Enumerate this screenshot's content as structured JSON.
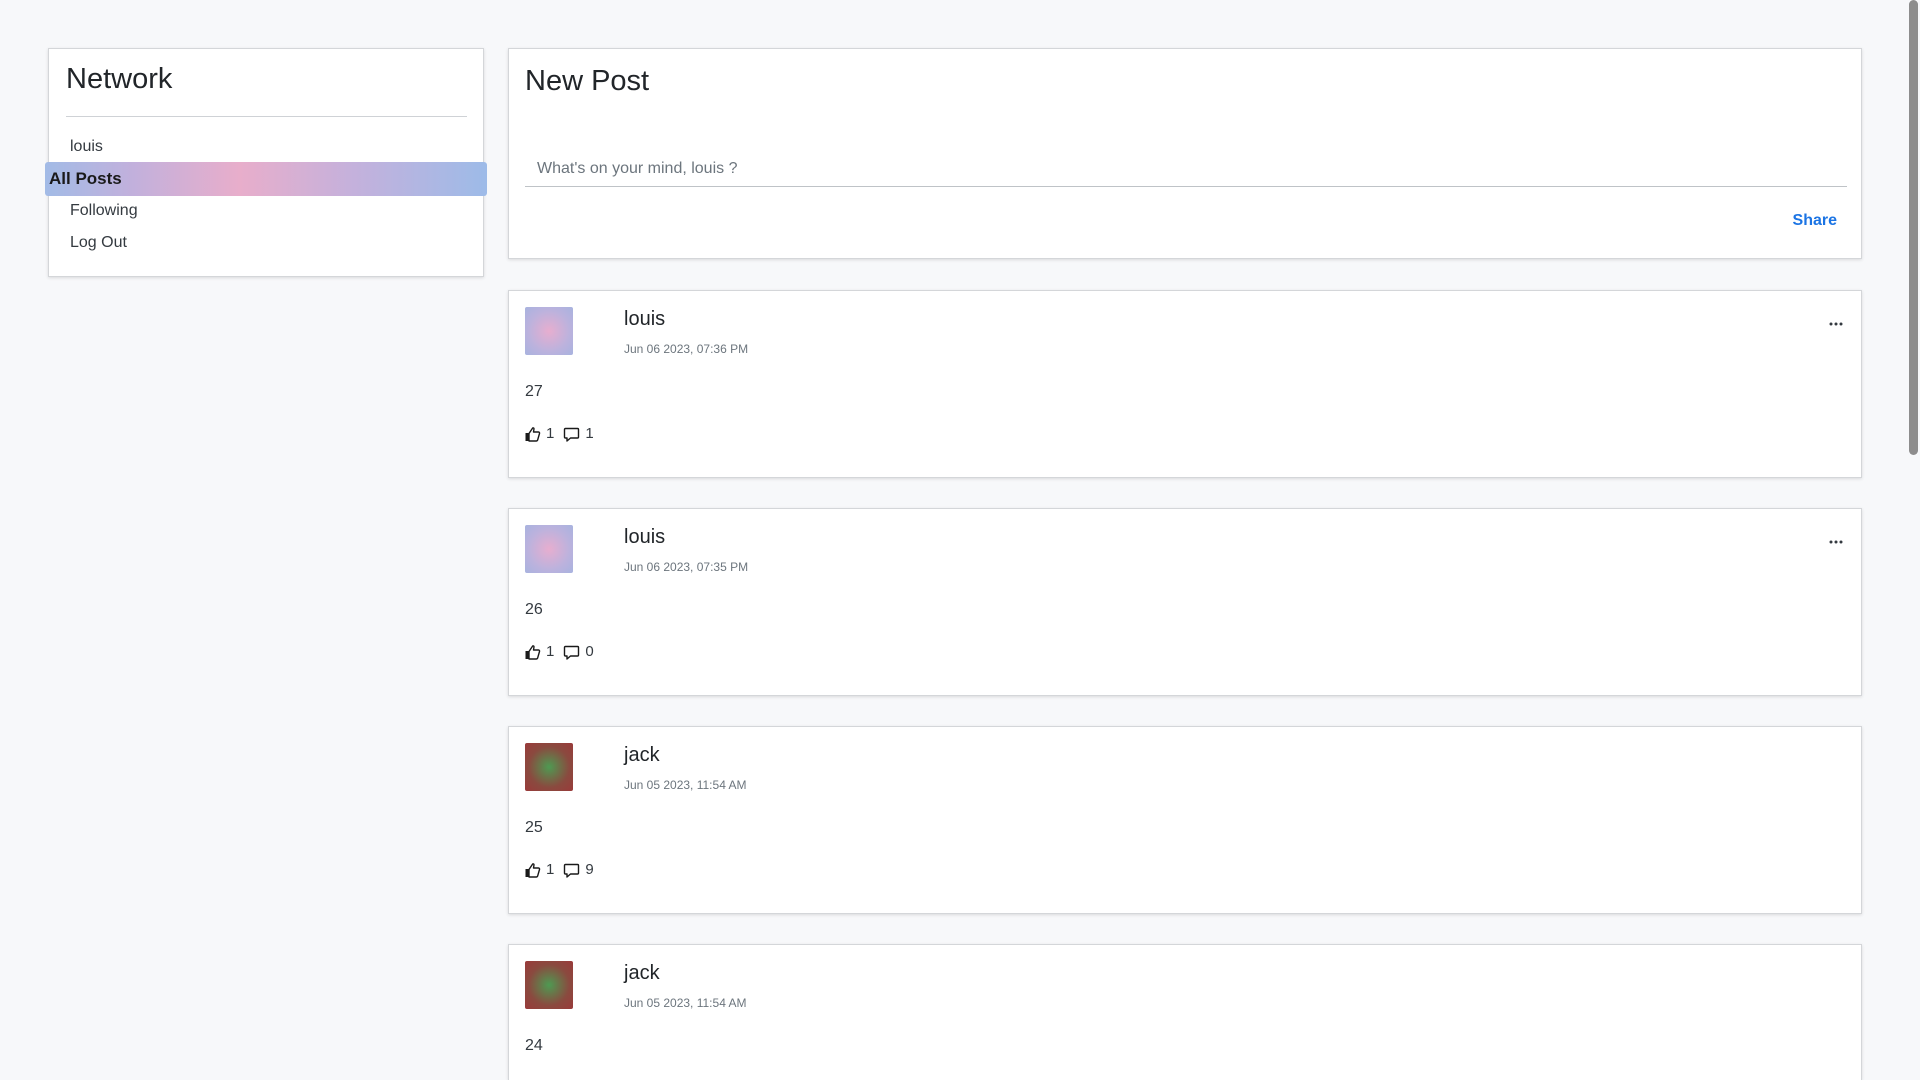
{
  "sidebar": {
    "title": "Network",
    "items": [
      {
        "label": "louis"
      },
      {
        "label": "All Posts"
      },
      {
        "label": "Following"
      },
      {
        "label": "Log Out"
      }
    ]
  },
  "compose": {
    "title": "New Post",
    "placeholder": "What's on your mind, louis ?",
    "share_label": "Share"
  },
  "posts": [
    {
      "user": "louis",
      "time": "Jun 06 2023, 07:36 PM",
      "body": "27",
      "likes": "1",
      "comments": "1",
      "has_menu": true,
      "avatar": "pink"
    },
    {
      "user": "louis",
      "time": "Jun 06 2023, 07:35 PM",
      "body": "26",
      "likes": "1",
      "comments": "0",
      "has_menu": true,
      "avatar": "pink"
    },
    {
      "user": "jack",
      "time": "Jun 05 2023, 11:54 AM",
      "body": "25",
      "likes": "1",
      "comments": "9",
      "has_menu": false,
      "avatar": "green"
    },
    {
      "user": "jack",
      "time": "Jun 05 2023, 11:54 AM",
      "body": "24",
      "likes": "",
      "comments": "",
      "has_menu": false,
      "avatar": "green"
    }
  ],
  "icons": {
    "menu": "ellipsis-icon",
    "like": "thumbs-up-icon",
    "comment": "comment-icon"
  }
}
